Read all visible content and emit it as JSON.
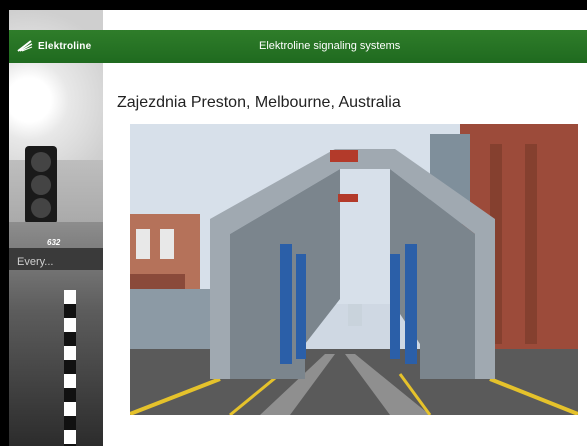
{
  "header": {
    "logo_text": "Elektroline",
    "title": "Elektroline signaling systems"
  },
  "slide": {
    "title": "Zajezdnia Preston, Melbourne, Australia"
  },
  "side_photo": {
    "tram_number": "632",
    "tram_destination": "Every..."
  },
  "colors": {
    "header_green": "#2a7527",
    "frame_black": "#000000"
  }
}
